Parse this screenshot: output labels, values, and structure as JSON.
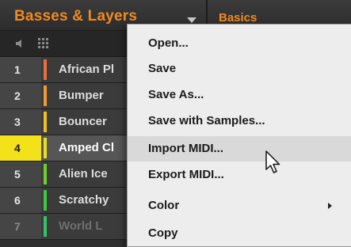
{
  "header": {
    "group_title": "Basses & Layers",
    "panel_title": "Basics"
  },
  "toolbar": {
    "speaker_icon": "speaker-icon",
    "grid_icon": "grid-icon"
  },
  "sounds": [
    {
      "index": "1",
      "name": "African Pl",
      "color": "#e8703a",
      "selected": false
    },
    {
      "index": "2",
      "name": "Bumper",
      "color": "#f09a2a",
      "selected": false
    },
    {
      "index": "3",
      "name": "Bouncer",
      "color": "#f0c020",
      "selected": false
    },
    {
      "index": "4",
      "name": "Amped Cl",
      "color": "#e8e020",
      "selected": true
    },
    {
      "index": "5",
      "name": "Alien Ice",
      "color": "#6fd02a",
      "selected": false
    },
    {
      "index": "6",
      "name": "Scratchy",
      "color": "#3fc83a",
      "selected": false
    },
    {
      "index": "7",
      "name": "World L",
      "color": "#35c06a",
      "selected": false
    }
  ],
  "context_menu": {
    "items": [
      {
        "label": "Open...",
        "has_submenu": false,
        "hovered": false
      },
      {
        "label": "Save",
        "has_submenu": false,
        "hovered": false
      },
      {
        "label": "Save As...",
        "has_submenu": false,
        "hovered": false
      },
      {
        "label": "Save with Samples...",
        "has_submenu": false,
        "hovered": false
      },
      {
        "label": "Import MIDI...",
        "has_submenu": false,
        "hovered": true
      },
      {
        "label": "Export MIDI...",
        "has_submenu": false,
        "hovered": false
      },
      {
        "label": "Color",
        "has_submenu": true,
        "hovered": false
      },
      {
        "label": "Copy",
        "has_submenu": false,
        "hovered": false
      }
    ]
  },
  "colors": {
    "accent_orange": "#f28a1e",
    "selected_yellow": "#f3e21a",
    "menu_background": "#ededed",
    "strip_green": "#5bd23a"
  }
}
